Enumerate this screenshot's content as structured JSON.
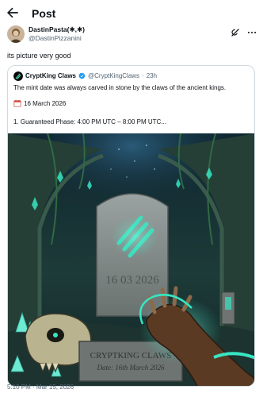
{
  "header": {
    "title": "Post"
  },
  "post": {
    "author_name": "DastinPasta(✱,✱)",
    "author_handle": "@DastinPizzanini",
    "text": "its picture very good",
    "timestamp": "5:10 PM · Mar 15, 2026"
  },
  "quote": {
    "author_name": "CryptKing Claws",
    "author_handle": "@CryptKingClaws",
    "age": "23h",
    "text": "The mint date was always carved in stone by the claws of the ancient kings.",
    "date_line": "16 March 2026",
    "phase_line": "1. Guaranteed Phase: 4:00 PM UTC – 8:00 PM UTC..."
  },
  "artwork": {
    "stone_date": "16 03 2026",
    "plaque_title": "CRYPTKING CLAWS",
    "plaque_subtitle": "Date: 16th March 2026"
  },
  "icons": {
    "back": "arrow-left-icon",
    "grok": "grok-icon",
    "more": "ellipsis-icon",
    "verified": "verified-badge-icon",
    "calendar": "calendar-icon"
  },
  "colors": {
    "text": "#0f1419",
    "secondary": "#536471",
    "border": "#cfd9de",
    "verified": "#1d9bf0",
    "glow": "#37e6c2"
  }
}
